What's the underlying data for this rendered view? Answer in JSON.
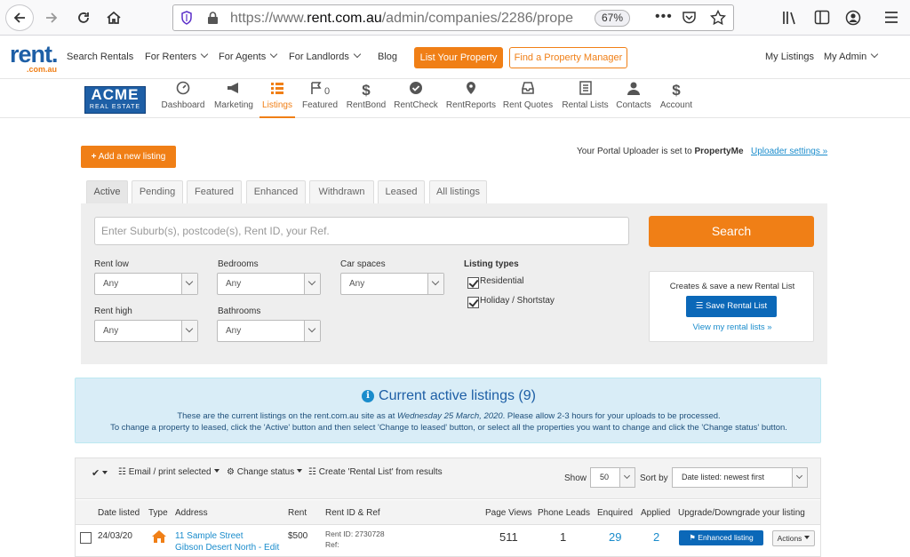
{
  "browser": {
    "url_prefix": "https://www.",
    "url_domain": "rent.com.au",
    "url_path": "/admin/companies/2286/prope",
    "zoom": "67%"
  },
  "header": {
    "logo_text": "rent.",
    "logo_sub": ".com.au",
    "nav": [
      "Search Rentals",
      "For Renters",
      "For Agents",
      "For Landlords",
      "Blog"
    ],
    "list_property": "List Your Property",
    "find_pm": "Find a Property Manager",
    "my_listings": "My Listings",
    "my_admin": "My Admin"
  },
  "company": {
    "logo_line1": "ACME",
    "logo_line2": "REAL ESTATE"
  },
  "dash_nav": [
    {
      "label": "Dashboard",
      "icon": "speedometer-icon"
    },
    {
      "label": "Marketing",
      "icon": "megaphone-icon"
    },
    {
      "label": "Listings",
      "icon": "list-icon"
    },
    {
      "label": "Featured",
      "icon": "flag-icon",
      "count": "0"
    },
    {
      "label": "RentBond",
      "icon": "dollar-icon"
    },
    {
      "label": "RentCheck",
      "icon": "check-circle-icon"
    },
    {
      "label": "RentReports",
      "icon": "map-pin-icon"
    },
    {
      "label": "Rent Quotes",
      "icon": "inbox-icon"
    },
    {
      "label": "Rental Lists",
      "icon": "document-list-icon"
    },
    {
      "label": "Contacts",
      "icon": "person-icon"
    },
    {
      "label": "Account",
      "icon": "dollar-icon"
    }
  ],
  "actions": {
    "add_listing": "Add a new listing",
    "uploader_prefix": "Your Portal Uploader is set to ",
    "uploader_name": "PropertyMe",
    "uploader_link": "Uploader settings »"
  },
  "tabs": [
    "Active",
    "Pending",
    "Featured",
    "Enhanced",
    "Withdrawn",
    "Leased",
    "All listings"
  ],
  "search": {
    "placeholder": "Enter Suburb(s), postcode(s), Rent ID, your Ref.",
    "button": "Search",
    "rent_low_label": "Rent low",
    "rent_low_value": "Any",
    "bedrooms_label": "Bedrooms",
    "bedrooms_value": "Any",
    "car_spaces_label": "Car spaces",
    "car_spaces_value": "Any",
    "rent_high_label": "Rent high",
    "rent_high_value": "Any",
    "bathrooms_label": "Bathrooms",
    "bathrooms_value": "Any",
    "listing_types_label": "Listing types",
    "type_residential": "Residential",
    "type_holiday": "Holiday / Shortstay"
  },
  "rental_list": {
    "title": "Creates & save a new Rental List",
    "save_button": "Save Rental List",
    "view_link": "View my rental lists »"
  },
  "info": {
    "title": "Current active listings (9)",
    "line1_prefix": "These are the current listings on the rent.com.au site as at ",
    "line1_date": "Wednesday 25 March, 2020",
    "line1_suffix": ". Please allow 2-3 hours for your uploads to be processed.",
    "line2": "To change a property to leased, click the 'Active' button and then select 'Change to leased' button, or select all the properties you want to change and click the 'Change status' button."
  },
  "toolbar": {
    "email_print": "Email / print selected",
    "change_status": "Change status",
    "create_list": "Create 'Rental List' from results",
    "show_label": "Show",
    "show_value": "50",
    "sort_label": "Sort by",
    "sort_value": "Date listed: newest first"
  },
  "table": {
    "headers": [
      "Date listed",
      "Type",
      "Address",
      "Rent",
      "Rent ID & Ref",
      "Page Views",
      "Phone Leads",
      "Enquired",
      "Applied",
      "Upgrade/Downgrade your listing"
    ],
    "rows": [
      {
        "date": "24/03/20",
        "type_icon": "house-icon",
        "address_line1": "11 Sample Street",
        "address_line2": "Gibson Desert North",
        "edit": "Edit",
        "rent": "$500",
        "rent_id": "Rent ID: 2730728",
        "ref": "Ref:",
        "page_views": "511",
        "phone_leads": "1",
        "enquired": "29",
        "applied": "2",
        "upgrade": "Enhanced listing",
        "actions": "Actions"
      }
    ]
  },
  "colors": {
    "brand_orange": "#f07f16",
    "brand_blue": "#1e5fa6",
    "link_blue": "#1a8ccc",
    "button_blue": "#0b68b8"
  }
}
